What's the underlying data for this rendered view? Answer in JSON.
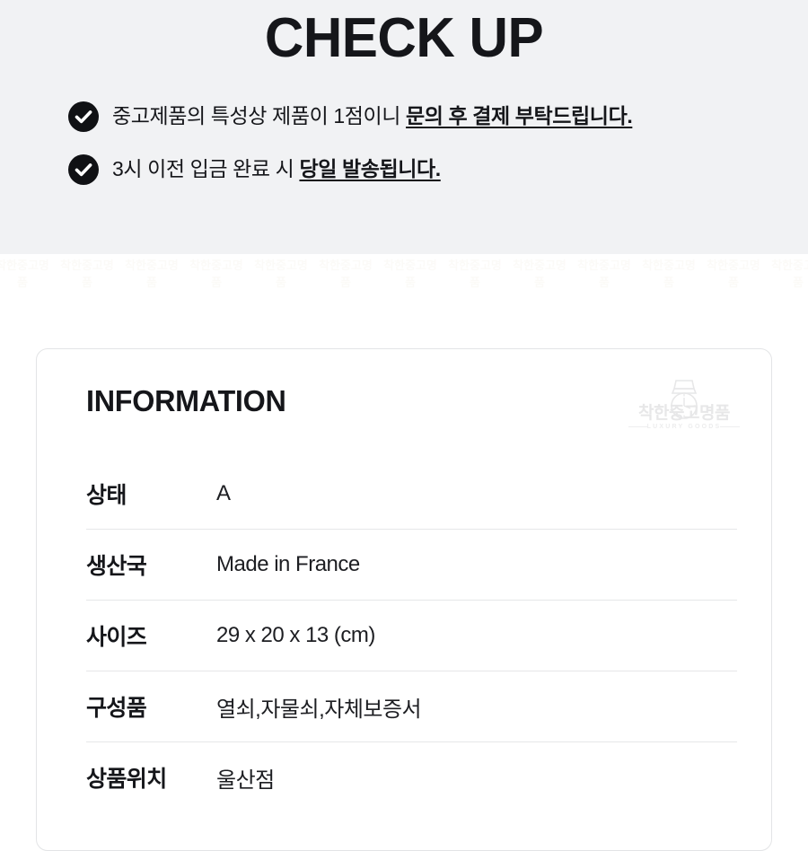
{
  "checkup": {
    "title": "CHECK UP",
    "items": [
      {
        "icon": "check-circle-icon",
        "text_normal": "중고제품의 특성상 제품이 1점이니 ",
        "text_strong": "문의 후 결제 부탁드립니다."
      },
      {
        "icon": "check-circle-icon",
        "text_normal": "3시 이전 입금 완료 시 ",
        "text_strong": "당일 발송됩니다."
      }
    ]
  },
  "information": {
    "heading": "INFORMATION",
    "watermark": {
      "name": "착한중고명품",
      "sub": "LUXURY GOODS"
    },
    "rows": [
      {
        "label": "상태",
        "value": "A"
      },
      {
        "label": "생산국",
        "value": "Made in France"
      },
      {
        "label": "사이즈",
        "value": "29 x 20 x 13 (cm)"
      },
      {
        "label": "구성품",
        "value": "열쇠,자물쇠,자체보증서"
      },
      {
        "label": "상품위치",
        "value": "울산점"
      }
    ]
  },
  "colors": {
    "band_background": "#f1f2f4",
    "page_background": "#ffffff",
    "text_primary": "#15161a",
    "divider": "#e6e7e8",
    "card_border": "#e3e4e6",
    "check_icon_fill": "#101114"
  }
}
